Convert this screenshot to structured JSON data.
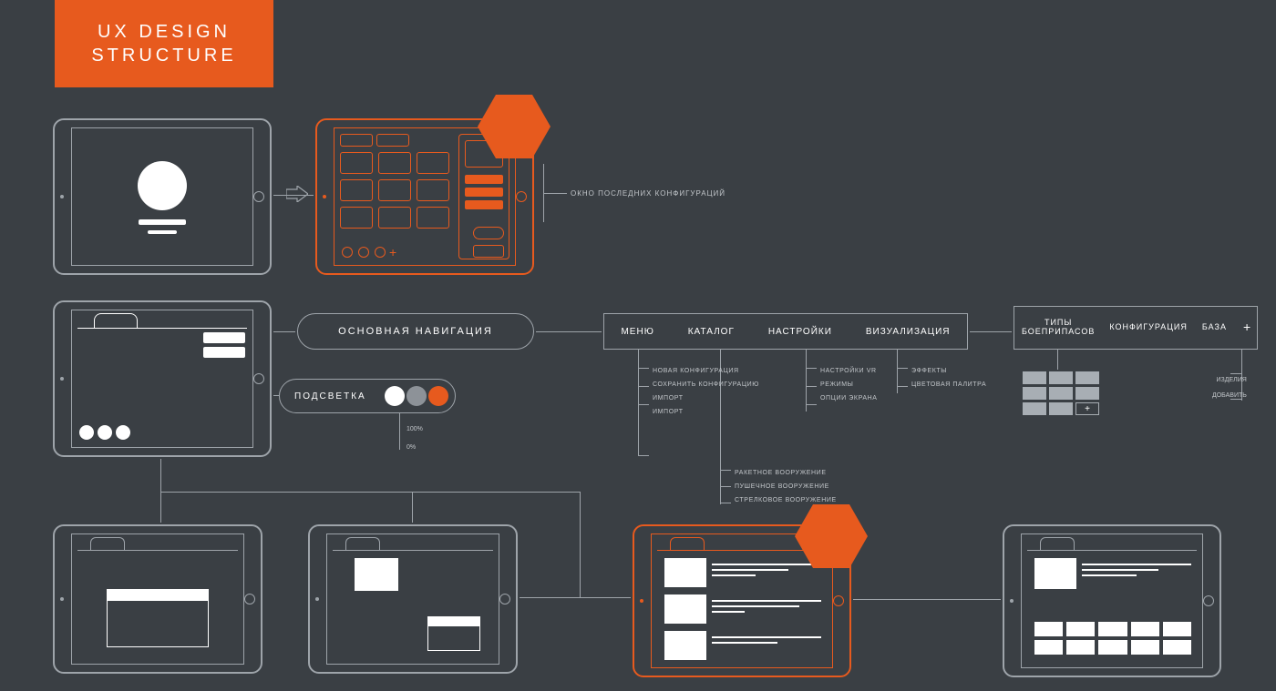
{
  "title": "UX DESIGN\nSTRUCTURE",
  "label_configs": "ОКНО ПОСЛЕДНИХ КОНФИГУРАЦИЙ",
  "main_nav_pill": "ОСНОВНАЯ НАВИГАЦИЯ",
  "lighting": {
    "label": "ПОДСВЕТКА",
    "swatches": [
      "#ffffff",
      "#8d9298",
      "#e75a1e"
    ],
    "ticks": [
      "100%",
      "0%"
    ]
  },
  "navbar": [
    "МЕНЮ",
    "КАТАЛОГ",
    "НАСТРОЙКИ",
    "ВИЗУАЛИЗАЦИЯ"
  ],
  "menu_items": [
    "НОВАЯ КОНФИГУРАЦИЯ",
    "СОХРАНИТЬ КОНФИГУРАЦИЮ",
    "ИМПОРТ",
    "ИМПОРТ"
  ],
  "settings_items": [
    "НАСТРОЙКИ VR",
    "РЕЖИМЫ",
    "ОПЦИИ ЭКРАНА"
  ],
  "visual_items": [
    "ЭФФЕКТЫ",
    "ЦВЕТОВАЯ ПАЛИТРА"
  ],
  "catalog_items": [
    "РАКЕТНОЕ ВООРУЖЕНИЕ",
    "ПУШЕЧНОЕ ВООРУЖЕНИЕ",
    "СТРЕЛКОВОЕ ВООРУЖЕНИЕ"
  ],
  "navbar2": {
    "col1_line1": "ТИПЫ",
    "col1_line2": "БОЕПРИПАСОВ",
    "col2": "КОНФИГУРАЦИЯ",
    "col3": "БАЗА",
    "plus": "+"
  },
  "right_list": [
    "ИЗДЕЛИЯ",
    "ДОБАВИТЬ"
  ],
  "plus": "+"
}
